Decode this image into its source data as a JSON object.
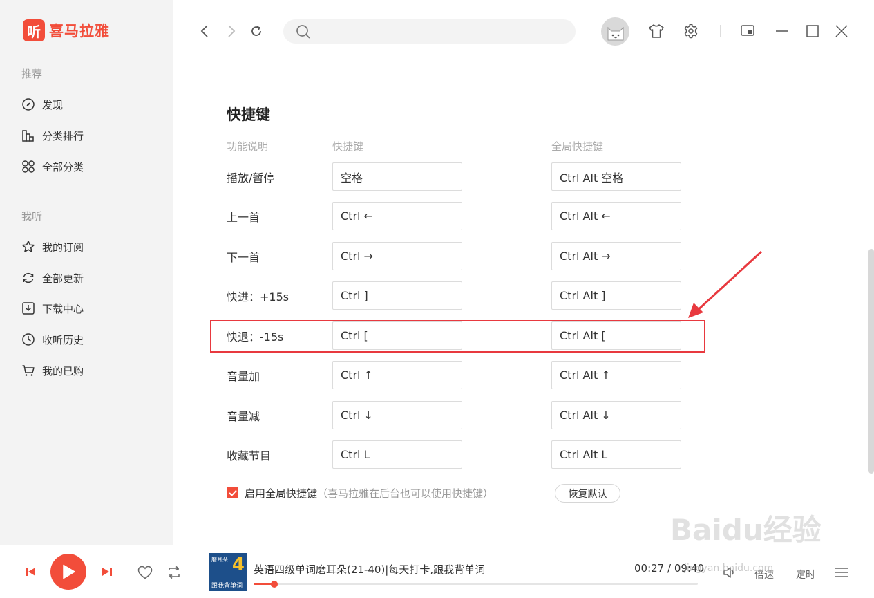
{
  "app": {
    "logo_glyph": "听",
    "name": "喜马拉雅",
    "brand_color": "#f24d3a"
  },
  "sidebar": {
    "section_recommend": "推荐",
    "recommend_items": [
      {
        "label": "发现",
        "icon": "compass-icon"
      },
      {
        "label": "分类排行",
        "icon": "ranking-icon"
      },
      {
        "label": "全部分类",
        "icon": "category-grid-icon"
      }
    ],
    "section_mine": "我听",
    "mine_items": [
      {
        "label": "我的订阅",
        "icon": "star-icon"
      },
      {
        "label": "全部更新",
        "icon": "refresh-icon"
      },
      {
        "label": "下载中心",
        "icon": "download-icon"
      },
      {
        "label": "收听历史",
        "icon": "clock-icon"
      },
      {
        "label": "我的已购",
        "icon": "cart-icon"
      }
    ]
  },
  "topbar": {
    "search_placeholder": ""
  },
  "shortcuts": {
    "title": "快捷键",
    "col_function": "功能说明",
    "col_shortcut": "快捷键",
    "col_global": "全局快捷键",
    "rows": [
      {
        "label": "播放/暂停",
        "key": "空格",
        "global": "Ctrl Alt 空格"
      },
      {
        "label": "上一首",
        "key": "Ctrl ←",
        "global": "Ctrl Alt ←"
      },
      {
        "label": "下一首",
        "key": "Ctrl →",
        "global": "Ctrl Alt →"
      },
      {
        "label": "快进：+15s",
        "key": "Ctrl ]",
        "global": "Ctrl Alt ]"
      },
      {
        "label": "快退：-15s",
        "key": "Ctrl [",
        "global": "Ctrl Alt ["
      },
      {
        "label": "音量加",
        "key": "Ctrl ↑",
        "global": "Ctrl Alt ↑"
      },
      {
        "label": "音量减",
        "key": "Ctrl ↓",
        "global": "Ctrl Alt ↓"
      },
      {
        "label": "收藏节目",
        "key": "Ctrl L",
        "global": "Ctrl Alt L"
      }
    ],
    "enable_global_label": "启用全局快捷键",
    "enable_global_hint": "（喜马拉雅在后台也可以使用快捷键）",
    "enable_global_checked": true,
    "restore_default": "恢复默认"
  },
  "player": {
    "cover_number": "4",
    "cover_text_top": "磨耳朵",
    "cover_text_bottom": "跟我背单词",
    "track_title": "英语四级单词磨耳朵(21-40)|每天打卡,跟我背单词",
    "time": "00:27 / 09:40",
    "progress_fraction": 0.047,
    "speed_label": "倍速",
    "timer_label": "定时"
  },
  "watermark": {
    "brand": "Baidu经验",
    "url": "jingyan.baidu.com"
  }
}
